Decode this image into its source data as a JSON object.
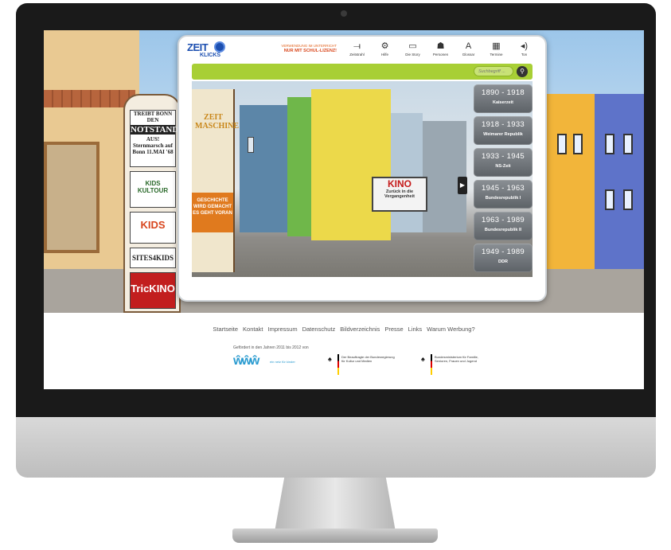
{
  "app": {
    "logo_word": "ZEIT",
    "logo_sub": "KLICKS",
    "notice_line1": "VERWENDUNG IM UNTERRICHT",
    "notice_line2": "NUR MIT SCHUL-LIZENZ!",
    "toolbar": [
      {
        "label": "Zeitstrahl",
        "icon": "timeline-icon"
      },
      {
        "label": "Hilfe",
        "icon": "help-icon"
      },
      {
        "label": "Die Story",
        "icon": "story-icon"
      },
      {
        "label": "Personen",
        "icon": "person-icon"
      },
      {
        "label": "Glossar",
        "icon": "glossary-icon"
      },
      {
        "label": "Termine",
        "icon": "calendar-icon"
      },
      {
        "label": "Ton",
        "icon": "sound-icon"
      }
    ],
    "search_placeholder": "Suchbegriff ...",
    "eras": [
      {
        "years": "1890 - 1918",
        "name": "Kaiserzeit"
      },
      {
        "years": "1918 - 1933",
        "name": "Weimarer Republik"
      },
      {
        "years": "1933 - 1945",
        "name": "NS-Zeit"
      },
      {
        "years": "1945 - 1963",
        "name": "Bundesrepublik I"
      },
      {
        "years": "1963 - 1989",
        "name": "Bundesrepublik II"
      },
      {
        "years": "1949 - 1989",
        "name": "DDR"
      }
    ],
    "scene": {
      "kino": "KINO",
      "kino_sub": "Zurück in die Vergangenheit",
      "poster_title": "ZEIT MASCHINE",
      "poster_strip": "GESCHICHTE WIRD GEMACHT ES GEHT VORAN"
    }
  },
  "pillar": {
    "notstand_top": "TREIBT BONN DEN",
    "notstand_big": "NOTSTAND",
    "notstand_bottom": "AUS! Sternmarsch auf Bonn 11.MAI '68",
    "kultour": "KIDS KULTOUR",
    "kids": "KIDS",
    "sites": "SITES4KIDS",
    "tric": "TricKINO"
  },
  "footer": {
    "links": [
      "Startseite",
      "Kontakt",
      "Impressum",
      "Datenschutz",
      "Bildverzeichnis",
      "Presse",
      "Links",
      "Warum Werbung?"
    ],
    "funding_text": "Gefördert in den Jahren 2011 bis 2012 von",
    "www_tag": "ein netz für kinder",
    "sponsor_bkm": "Der Beauftragte der Bundesregierung für Kultur und Medien",
    "sponsor_bmfsfj": "Bundesministerium für Familie, Senioren, Frauen und Jugend"
  }
}
